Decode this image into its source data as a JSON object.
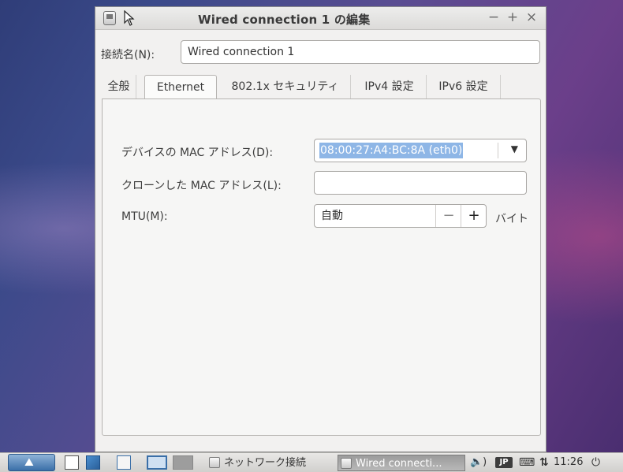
{
  "window": {
    "title": "Wired connection 1 の編集",
    "controls": {
      "minimize": "−",
      "maximize": "+",
      "close": "×"
    }
  },
  "connection_name": {
    "label": "接続名(N):",
    "value": "Wired connection 1"
  },
  "tabs": [
    {
      "label": "全般",
      "active": false
    },
    {
      "label": "Ethernet",
      "active": true
    },
    {
      "label": "802.1x セキュリティ",
      "active": false
    },
    {
      "label": "IPv4 設定",
      "active": false
    },
    {
      "label": "IPv6 設定",
      "active": false
    }
  ],
  "ethernet": {
    "device_mac": {
      "label": "デバイスの MAC アドレス(D):",
      "value": "08:00:27:A4:BC:8A (eth0)"
    },
    "cloned_mac": {
      "label": "クローンした MAC アドレス(L):",
      "value": ""
    },
    "mtu": {
      "label": "MTU(M):",
      "value": "自動",
      "minus": "−",
      "plus": "+",
      "unit": "バイト"
    }
  },
  "taskbar": {
    "tasks": [
      {
        "label": "ネットワーク接続",
        "active": false
      },
      {
        "label": "Wired connecti...",
        "active": true
      }
    ],
    "volume_icon": "🔈)",
    "keyboard_layout": "JP",
    "clock": "11:26",
    "colors": {
      "accent": "#3a6fa8",
      "selection": "#8eb6e6"
    }
  }
}
